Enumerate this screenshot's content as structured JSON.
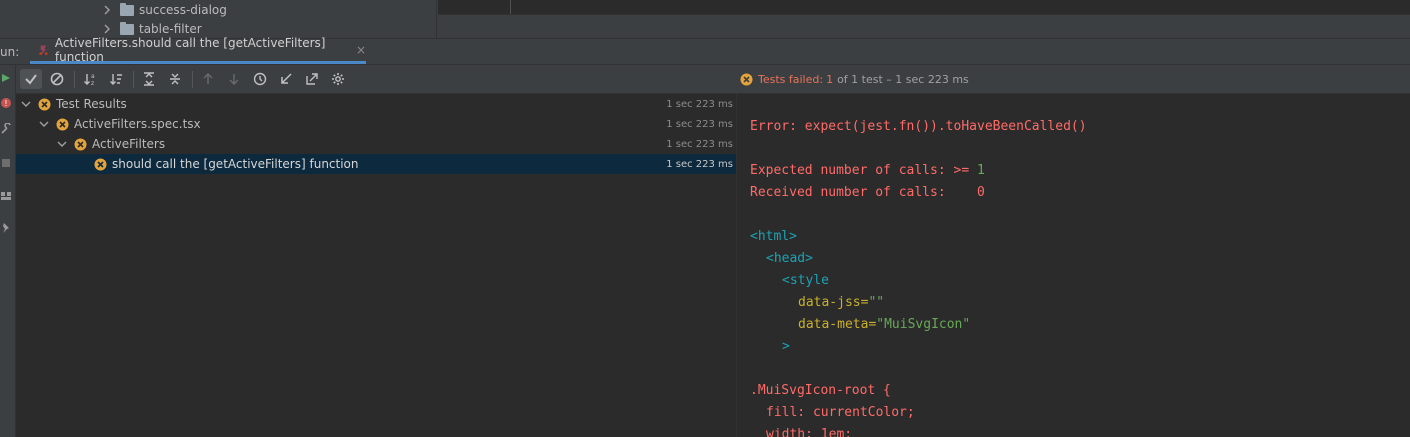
{
  "project_tree": {
    "folders": [
      {
        "label": "success-dialog",
        "icon": "folder-icon"
      },
      {
        "label": "table-filter",
        "icon": "folder-icon"
      }
    ]
  },
  "run_bar": {
    "label": "un:",
    "tab_title": "ActiveFilters.should call the [getActiveFilters] function",
    "close_glyph": "×"
  },
  "status": {
    "failed_label": "Tests failed:",
    "failed_detail": "1",
    "rest": "of 1 test – 1 sec 223 ms"
  },
  "test_tree": [
    {
      "label": "Test Results",
      "time": "1 sec 223 ms",
      "level": 0,
      "expanded": true
    },
    {
      "label": "ActiveFilters.spec.tsx",
      "time": "1 sec 223 ms",
      "level": 1,
      "expanded": true
    },
    {
      "label": "ActiveFilters",
      "time": "1 sec 223 ms",
      "level": 2,
      "expanded": true
    },
    {
      "label": "should call the [getActiveFilters] function",
      "time": "1 sec 223 ms",
      "level": 3,
      "selected": true
    }
  ],
  "console": {
    "error_prefix": "Error: expect(",
    "error_fn": "jest.fn()",
    "error_suffix": ").toHaveBeenCalled()",
    "expected_label": "Expected number of calls: >= ",
    "expected_value": "1",
    "received_label": "Received number of calls:    ",
    "received_value": "0",
    "html_open": "<html>",
    "head_open": "<head>",
    "style_open": "<style",
    "attr1_name": "data-jss=",
    "attr1_value": "\"\"",
    "attr2_name": "data-meta=",
    "attr2_value": "\"MuiSvgIcon\"",
    "tag_close": ">",
    "css_selector": ".MuiSvgIcon-root {",
    "css_line1": "fill: currentColor;",
    "css_line2": "width: 1em;"
  },
  "colors": {
    "accent": "#4a88c7",
    "fail": "#e5735a",
    "error_text": "#ff6b68",
    "selection": "#0d293e"
  }
}
